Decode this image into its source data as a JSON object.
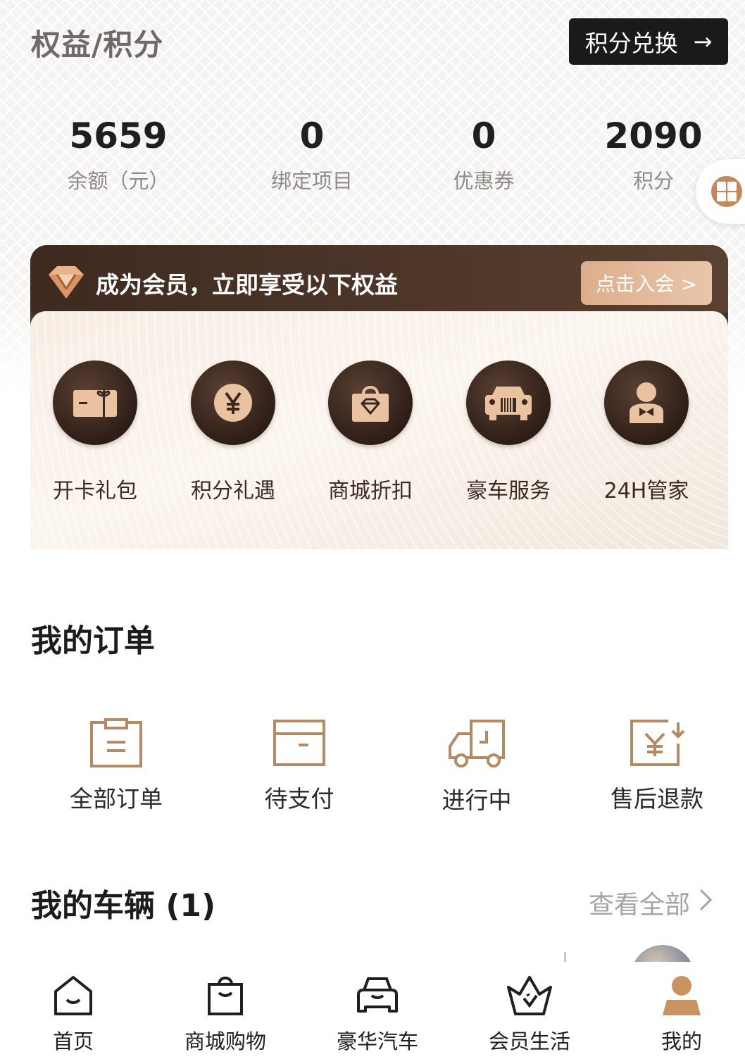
{
  "header": {
    "title": "权益/积分",
    "exchange_label": "积分兑换"
  },
  "stats": [
    {
      "value": "5659",
      "label": "余额（元）"
    },
    {
      "value": "0",
      "label": "绑定项目"
    },
    {
      "value": "0",
      "label": "优惠券"
    },
    {
      "value": "2090",
      "label": "积分"
    }
  ],
  "membership": {
    "title": "成为会员，立即享受以下权益",
    "join_label": "点击入会 >",
    "perks": [
      {
        "label": "开卡礼包",
        "icon": "gift-card-icon"
      },
      {
        "label": "积分礼遇",
        "icon": "yen-coin-icon"
      },
      {
        "label": "商城折扣",
        "icon": "diamond-bag-icon"
      },
      {
        "label": "豪车服务",
        "icon": "luxury-car-icon"
      },
      {
        "label": "24H管家",
        "icon": "butler-icon"
      }
    ]
  },
  "orders": {
    "title": "我的订单",
    "items": [
      {
        "label": "全部订单",
        "icon": "clipboard-icon"
      },
      {
        "label": "待支付",
        "icon": "wallet-icon"
      },
      {
        "label": "进行中",
        "icon": "delivery-truck-icon"
      },
      {
        "label": "售后退款",
        "icon": "refund-icon"
      }
    ]
  },
  "vehicles": {
    "title": "我的车辆 (1)",
    "view_all": "查看全部"
  },
  "bottom_nav": [
    {
      "label": "首页",
      "icon": "home-icon"
    },
    {
      "label": "商城购物",
      "icon": "shopping-bag-icon"
    },
    {
      "label": "豪华汽车",
      "icon": "car-icon"
    },
    {
      "label": "会员生活",
      "icon": "crown-icon"
    },
    {
      "label": "我的",
      "icon": "profile-icon",
      "active": true
    }
  ],
  "colors": {
    "accent": "#c4895a",
    "dark": "#1b1a19",
    "card_dark": "#4a3427",
    "order_icon": "#b58a63"
  }
}
